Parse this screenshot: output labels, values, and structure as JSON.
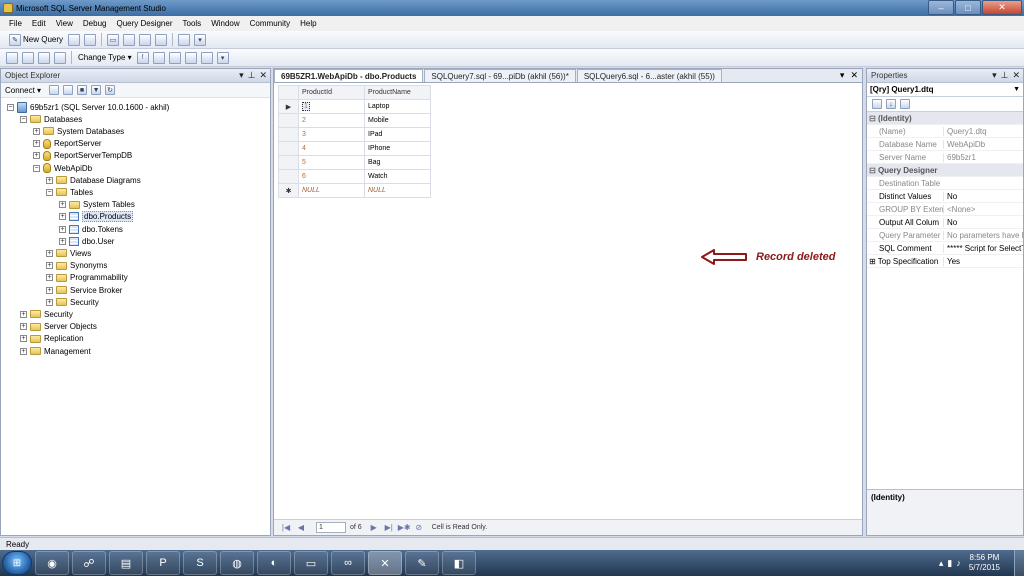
{
  "window": {
    "title": "Microsoft SQL Server Management Studio",
    "minimize": "–",
    "maximize": "□",
    "close": "✕"
  },
  "menu": [
    "File",
    "Edit",
    "View",
    "Debug",
    "Query Designer",
    "Tools",
    "Window",
    "Community",
    "Help"
  ],
  "toolbar": {
    "new_query": "New Query",
    "change_type": "Change Type ▾"
  },
  "object_explorer": {
    "title": "Object Explorer",
    "connect": "Connect ▾",
    "tree": [
      {
        "label": "69b5zr1 (SQL Server 10.0.1600 - akhil)",
        "icon": "server-icon",
        "expanded": true
      },
      {
        "label": "Databases",
        "icon": "folder-icon",
        "expanded": true
      },
      {
        "label": "System Databases",
        "icon": "folder-icon",
        "expanded": false
      },
      {
        "label": "ReportServer",
        "icon": "database-icon",
        "expanded": false
      },
      {
        "label": "ReportServerTempDB",
        "icon": "database-icon",
        "expanded": false
      },
      {
        "label": "WebApiDb",
        "icon": "database-icon",
        "expanded": true
      },
      {
        "label": "Database Diagrams",
        "icon": "folder-icon",
        "expanded": false
      },
      {
        "label": "Tables",
        "icon": "folder-icon",
        "expanded": true
      },
      {
        "label": "System Tables",
        "icon": "folder-icon",
        "expanded": false
      },
      {
        "label": "dbo.Products",
        "icon": "table-icon",
        "expanded": false,
        "selected": true
      },
      {
        "label": "dbo.Tokens",
        "icon": "table-icon",
        "expanded": false
      },
      {
        "label": "dbo.User",
        "icon": "table-icon",
        "expanded": false
      },
      {
        "label": "Views",
        "icon": "folder-icon",
        "expanded": false
      },
      {
        "label": "Synonyms",
        "icon": "folder-icon",
        "expanded": false
      },
      {
        "label": "Programmability",
        "icon": "folder-icon",
        "expanded": false
      },
      {
        "label": "Service Broker",
        "icon": "folder-icon",
        "expanded": false
      },
      {
        "label": "Security",
        "icon": "folder-icon",
        "expanded": false
      },
      {
        "label": "Security",
        "icon": "folder-icon",
        "expanded": false
      },
      {
        "label": "Server Objects",
        "icon": "folder-icon",
        "expanded": false
      },
      {
        "label": "Replication",
        "icon": "folder-icon",
        "expanded": false
      },
      {
        "label": "Management",
        "icon": "folder-icon",
        "expanded": false
      }
    ]
  },
  "document": {
    "tabs": [
      {
        "label": "69B5ZR1.WebApiDb - dbo.Products",
        "active": true
      },
      {
        "label": "SQLQuery7.sql - 69...piDb (akhil (56))*",
        "active": false
      },
      {
        "label": "SQLQuery6.sql - 6...aster (akhil (55))",
        "active": false
      }
    ],
    "grid": {
      "columns": [
        "ProductId",
        "ProductName"
      ],
      "rows": [
        [
          "1",
          "Laptop"
        ],
        [
          "2",
          "Mobile"
        ],
        [
          "3",
          "IPad"
        ],
        [
          "4",
          "IPhone"
        ],
        [
          "5",
          "Bag"
        ],
        [
          "6",
          "Watch"
        ]
      ],
      "new_row": [
        "NULL",
        "NULL"
      ],
      "current_marker": "▶",
      "new_marker": "✱"
    },
    "annotation": "Record deleted",
    "nav": {
      "position": "1",
      "of": "of 6",
      "status": "Cell is Read Only."
    }
  },
  "properties": {
    "title": "Properties",
    "selected_object": "[Qry] Query1.dtq",
    "rows": [
      {
        "type": "cat",
        "name": "(Identity)"
      },
      {
        "type": "prop",
        "name": "(Name)",
        "value": "Query1.dtq",
        "gray": true
      },
      {
        "type": "prop",
        "name": "Database Name",
        "value": "WebApiDb",
        "gray": true
      },
      {
        "type": "prop",
        "name": "Server Name",
        "value": "69b5zr1",
        "gray": true
      },
      {
        "type": "cat",
        "name": "Query Designer"
      },
      {
        "type": "prop",
        "name": "Destination Table",
        "value": "",
        "gray": true
      },
      {
        "type": "prop",
        "name": "Distinct Values",
        "value": "No",
        "gray": false
      },
      {
        "type": "prop",
        "name": "GROUP BY Extens",
        "value": "<None>",
        "gray": true
      },
      {
        "type": "prop",
        "name": "Output All Colum",
        "value": "No",
        "gray": false
      },
      {
        "type": "prop",
        "name": "Query Parameter",
        "value": "No parameters have b",
        "gray": true
      },
      {
        "type": "prop",
        "name": "SQL Comment",
        "value": "***** Script for SelectT",
        "gray": false
      },
      {
        "type": "prop",
        "name": "Top Specification",
        "value": "Yes",
        "gray": false,
        "expandable": true
      }
    ],
    "description_title": "(Identity)"
  },
  "status": {
    "text": "Ready"
  },
  "taskbar": {
    "clock_time": "8:56 PM",
    "clock_date": "5/7/2015"
  },
  "colors": {
    "annotation": "#8b1a1a",
    "titlebar": "#3b6ea5"
  }
}
